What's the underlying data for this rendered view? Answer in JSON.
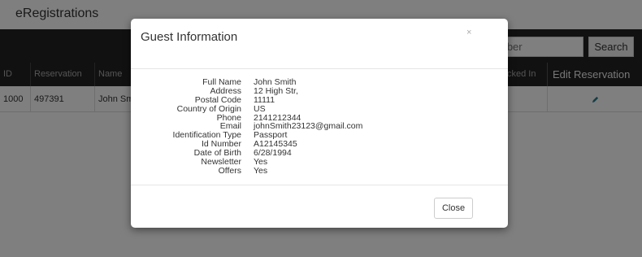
{
  "app": {
    "title": "eRegistrations"
  },
  "search": {
    "placeholder": "Number",
    "visible_placeholder": "mber",
    "button_label": "Search"
  },
  "table": {
    "headers": [
      "ID",
      "Reservation",
      "Name",
      "cked In",
      "Edit Reservation"
    ],
    "rows": [
      {
        "id": "1000",
        "reservation": "497391",
        "name": "John Sm"
      }
    ]
  },
  "modal": {
    "title": "Guest Information",
    "close_symbol": "×",
    "fields": [
      {
        "label": "Full Name",
        "value": "John Smith"
      },
      {
        "label": "Address",
        "value": "12 High Str,"
      },
      {
        "label": "Postal Code",
        "value": "11111"
      },
      {
        "label": "Country of Origin",
        "value": "US"
      },
      {
        "label": "Phone",
        "value": "2141212344"
      },
      {
        "label": "Email",
        "value": "johnSmith23123@gmail.com"
      },
      {
        "label": "Identification Type",
        "value": "Passport"
      },
      {
        "label": "Id Number",
        "value": "A12145345"
      },
      {
        "label": "Date of Birth",
        "value": "6/28/1994"
      },
      {
        "label": "Newsletter",
        "value": "Yes"
      },
      {
        "label": "Offers",
        "value": "Yes"
      }
    ],
    "close_button": "Close"
  },
  "colors": {
    "navbar": "#222222",
    "edit_icon": "#2a7a8c"
  }
}
